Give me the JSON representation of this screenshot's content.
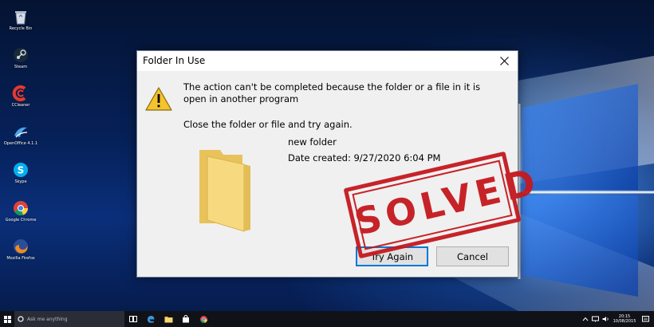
{
  "desktop": {
    "icons": [
      {
        "name": "recycle-bin-icon",
        "label": "Recycle Bin"
      },
      {
        "name": "steam-icon",
        "label": "Steam"
      },
      {
        "name": "ccleaner-icon",
        "label": "CCleaner"
      },
      {
        "name": "openoffice-icon",
        "label": "OpenOffice 4.1.1"
      },
      {
        "name": "skype-icon",
        "label": "Skype"
      },
      {
        "name": "chrome-icon",
        "label": "Google Chrome"
      },
      {
        "name": "firefox-icon",
        "label": "Mozilla Firefox"
      }
    ]
  },
  "dialog": {
    "title": "Folder In Use",
    "message": "The action can't be completed because the folder or a file in it is open in another program",
    "instruction": "Close the folder or file and try again.",
    "folder_name": "new folder",
    "date_created": "Date created: 9/27/2020 6:04 PM",
    "try_again_label": "Try Again",
    "cancel_label": "Cancel",
    "warning_icon": "warning-icon",
    "folder_icon": "folder-icon"
  },
  "overlay": {
    "stamp_text": "SOLVED",
    "stamp_color": "#c4191f"
  },
  "taskbar": {
    "search_placeholder": "Ask me anything",
    "apps": [
      "task-view-icon",
      "edge-icon",
      "file-explorer-icon",
      "store-icon",
      "chrome-icon"
    ],
    "clock_time": "20:15",
    "clock_date": "10/08/2015"
  },
  "colors": {
    "accent": "#0078d7",
    "dialog_bg": "#f0f0f0",
    "taskbar_bg": "#101217"
  }
}
